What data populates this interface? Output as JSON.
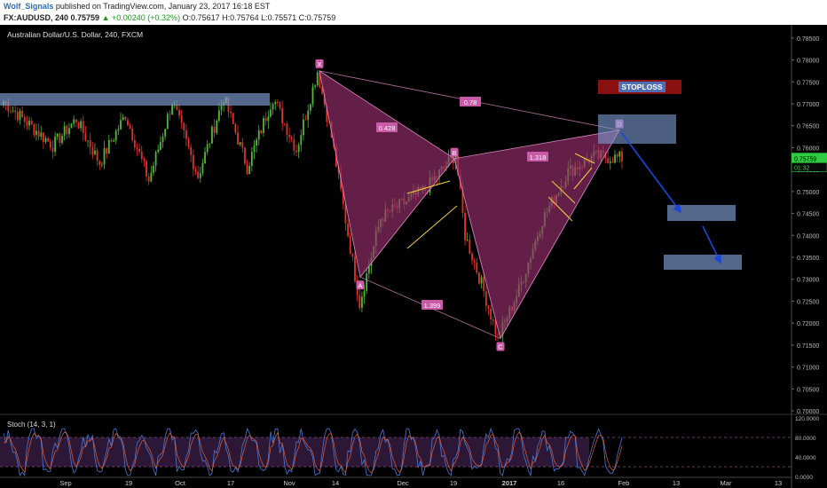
{
  "header": {
    "author": "Wolf_Signals",
    "published": "published on TradingView.com, January 23, 2017 16:18 EST",
    "symbol": "FX:AUDUSD, 240",
    "last": "0.75759",
    "change": "▲ +0.00240 (+0.32%)",
    "ohlc": "O:0.75617 H:0.75764 L:0.75571 C:0.75759"
  },
  "chart_title": "Australian Dollar/U.S. Dollar, 240, FXCM",
  "price_label": "0.75759",
  "countdown_label": "01:32",
  "stoch_title": "Stoch (14, 3, 1)",
  "chart_data": {
    "type": "candlestick",
    "title": "Australian Dollar/U.S. Dollar, 240, FXCM",
    "ylim": [
      0.7,
      0.79
    ],
    "y_ticks": [
      "0.78500",
      "0.78000",
      "0.77500",
      "0.77000",
      "0.76500",
      "0.76000",
      "0.75500",
      "0.75000",
      "0.74500",
      "0.74000",
      "0.73500",
      "0.73000",
      "0.72500",
      "0.72000",
      "0.71500",
      "0.71000",
      "0.70500",
      "0.70000"
    ],
    "x_ticks": [
      "Sep",
      "19",
      "Oct",
      "17",
      "Nov",
      "14",
      "Dec",
      "19",
      "2017",
      "16",
      "Feb",
      "13",
      "Mar",
      "13"
    ],
    "price_path": [
      0.7705,
      0.7605,
      0.7665,
      0.7565,
      0.7675,
      0.7525,
      0.7705,
      0.7535,
      0.7715,
      0.7555,
      0.7715,
      0.7595,
      0.7775,
      0.7625,
      0.7245,
      0.744,
      0.7505,
      0.7585,
      0.74,
      0.729,
      0.7165,
      0.7275,
      0.7435,
      0.7545,
      0.758,
      0.7576
    ],
    "harmonic_points": [
      {
        "label": "X",
        "price": 0.7775
      },
      {
        "label": "A",
        "price": 0.7305
      },
      {
        "label": "B",
        "price": 0.7575
      },
      {
        "label": "C",
        "price": 0.7165
      },
      {
        "label": "D",
        "price": 0.764
      }
    ],
    "ratios": [
      "0.428",
      "0.78",
      "1.318",
      "1.399"
    ],
    "stoploss_label": "STOPLOSS",
    "stoch": {
      "ylim": [
        0,
        120
      ],
      "y_ticks": [
        "120.0000",
        "80.0000",
        "40.0000",
        "0.0000"
      ],
      "bands": [
        20,
        80
      ]
    }
  },
  "colors": {
    "background": "#000000",
    "up_candle": "#53b73a",
    "down_candle": "#e0332b",
    "pattern_fill": "#9a2f6e",
    "pattern_line": "#e08ac6",
    "zone_fill": "#7f9fd6",
    "stoploss": "#8b1111",
    "arrow": "#1c45d8",
    "trend_line": "#f4d23a",
    "price_tag": "#2ecc40"
  }
}
